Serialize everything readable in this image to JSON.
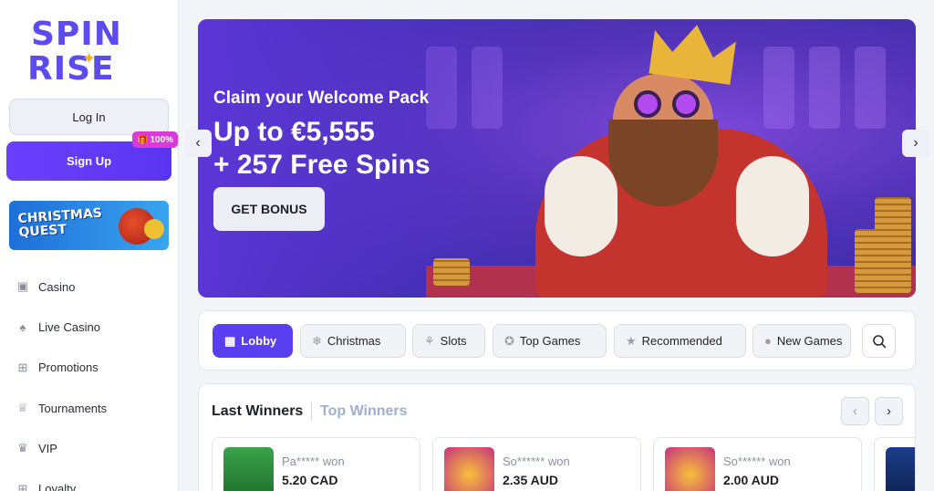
{
  "brand": {
    "logo_line1": "SPIN",
    "logo_line2": "RISE"
  },
  "auth": {
    "login_label": "Log In",
    "signup_label": "Sign Up",
    "signup_badge": "100%"
  },
  "sidebar": {
    "promo_banner_text": "CHRISTMAS QUEST",
    "items": [
      {
        "label": "Casino",
        "icon": "slot-icon"
      },
      {
        "label": "Live Casino",
        "icon": "spade-icon"
      },
      {
        "label": "Promotions",
        "icon": "gift-icon"
      },
      {
        "label": "Tournaments",
        "icon": "trophy-icon"
      },
      {
        "label": "VIP",
        "icon": "crown-icon"
      },
      {
        "label": "Loyalty",
        "icon": "gift-icon"
      }
    ]
  },
  "hero": {
    "kicker": "Claim your Welcome Pack",
    "title_line1": "Up to €5,555",
    "title_line2": "+ 257 Free Spins",
    "cta_label": "GET BONUS"
  },
  "categories": [
    {
      "label": "Lobby",
      "icon": "grid-icon",
      "active": true
    },
    {
      "label": "Christmas",
      "icon": "snowflake-icon",
      "active": false
    },
    {
      "label": "Slots",
      "icon": "cherry-icon",
      "active": false
    },
    {
      "label": "Top Games",
      "icon": "medal-icon",
      "active": false
    },
    {
      "label": "Recommended",
      "icon": "star-icon",
      "active": false
    },
    {
      "label": "New Games",
      "icon": "new-badge-icon",
      "active": false
    }
  ],
  "winners": {
    "tab_last": "Last Winners",
    "tab_top": "Top Winners",
    "entries": [
      {
        "name": "Pa*****",
        "won": "won",
        "amount": "5.20 CAD"
      },
      {
        "name": "So******",
        "won": "won",
        "amount": "2.35 AUD"
      },
      {
        "name": "So******",
        "won": "won",
        "amount": "2.00 AUD"
      }
    ]
  },
  "colors": {
    "accent": "#5a3ff0",
    "badge": "#d93bd6",
    "logo": "#5b4bf0"
  }
}
